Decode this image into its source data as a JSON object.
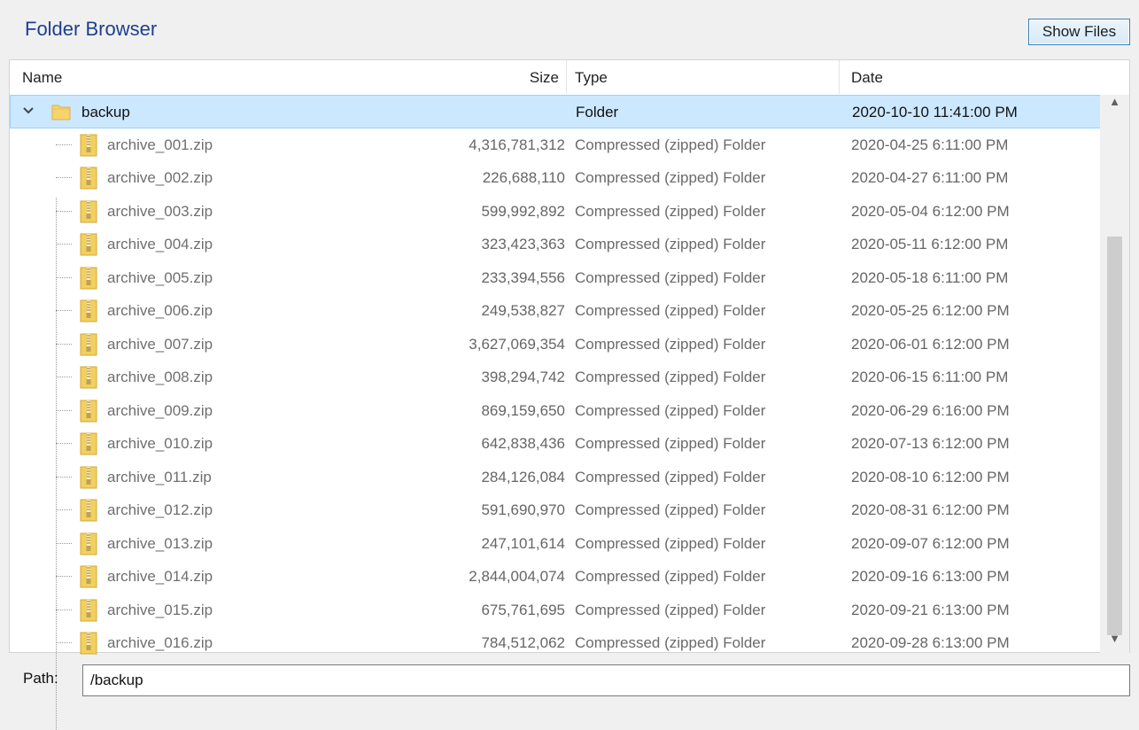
{
  "window": {
    "title": "Folder Browser",
    "show_files_label": "Show Files"
  },
  "columns": {
    "name": "Name",
    "size": "Size",
    "type": "Type",
    "date": "Date"
  },
  "tree": {
    "root": {
      "name": "backup",
      "size": "",
      "type": "Folder",
      "date": "2020-10-10 11:41:00 PM",
      "expanded": true,
      "selected": true,
      "icon": "folder-icon"
    },
    "children": [
      {
        "name": "archive_001.zip",
        "size": "4,316,781,312",
        "type": "Compressed (zipped) Folder",
        "date": "2020-04-25 6:11:00 PM",
        "icon": "zip-icon"
      },
      {
        "name": "archive_002.zip",
        "size": "226,688,110",
        "type": "Compressed (zipped) Folder",
        "date": "2020-04-27 6:11:00 PM",
        "icon": "zip-icon"
      },
      {
        "name": "archive_003.zip",
        "size": "599,992,892",
        "type": "Compressed (zipped) Folder",
        "date": "2020-05-04 6:12:00 PM",
        "icon": "zip-icon"
      },
      {
        "name": "archive_004.zip",
        "size": "323,423,363",
        "type": "Compressed (zipped) Folder",
        "date": "2020-05-11 6:12:00 PM",
        "icon": "zip-icon"
      },
      {
        "name": "archive_005.zip",
        "size": "233,394,556",
        "type": "Compressed (zipped) Folder",
        "date": "2020-05-18 6:11:00 PM",
        "icon": "zip-icon"
      },
      {
        "name": "archive_006.zip",
        "size": "249,538,827",
        "type": "Compressed (zipped) Folder",
        "date": "2020-05-25 6:12:00 PM",
        "icon": "zip-icon"
      },
      {
        "name": "archive_007.zip",
        "size": "3,627,069,354",
        "type": "Compressed (zipped) Folder",
        "date": "2020-06-01 6:12:00 PM",
        "icon": "zip-icon"
      },
      {
        "name": "archive_008.zip",
        "size": "398,294,742",
        "type": "Compressed (zipped) Folder",
        "date": "2020-06-15 6:11:00 PM",
        "icon": "zip-icon"
      },
      {
        "name": "archive_009.zip",
        "size": "869,159,650",
        "type": "Compressed (zipped) Folder",
        "date": "2020-06-29 6:16:00 PM",
        "icon": "zip-icon"
      },
      {
        "name": "archive_010.zip",
        "size": "642,838,436",
        "type": "Compressed (zipped) Folder",
        "date": "2020-07-13 6:12:00 PM",
        "icon": "zip-icon"
      },
      {
        "name": "archive_011.zip",
        "size": "284,126,084",
        "type": "Compressed (zipped) Folder",
        "date": "2020-08-10 6:12:00 PM",
        "icon": "zip-icon"
      },
      {
        "name": "archive_012.zip",
        "size": "591,690,970",
        "type": "Compressed (zipped) Folder",
        "date": "2020-08-31 6:12:00 PM",
        "icon": "zip-icon"
      },
      {
        "name": "archive_013.zip",
        "size": "247,101,614",
        "type": "Compressed (zipped) Folder",
        "date": "2020-09-07 6:12:00 PM",
        "icon": "zip-icon"
      },
      {
        "name": "archive_014.zip",
        "size": "2,844,004,074",
        "type": "Compressed (zipped) Folder",
        "date": "2020-09-16 6:13:00 PM",
        "icon": "zip-icon"
      },
      {
        "name": "archive_015.zip",
        "size": "675,761,695",
        "type": "Compressed (zipped) Folder",
        "date": "2020-09-21 6:13:00 PM",
        "icon": "zip-icon"
      },
      {
        "name": "archive_016.zip",
        "size": "784,512,062",
        "type": "Compressed (zipped) Folder",
        "date": "2020-09-28 6:13:00 PM",
        "icon": "zip-icon"
      }
    ]
  },
  "path": {
    "label": "Path:",
    "value": "/backup"
  },
  "colors": {
    "selection_bg": "#cce8ff",
    "selection_border": "#99d1ff",
    "title": "#1e3f8f",
    "folder": "#f6d36b"
  }
}
